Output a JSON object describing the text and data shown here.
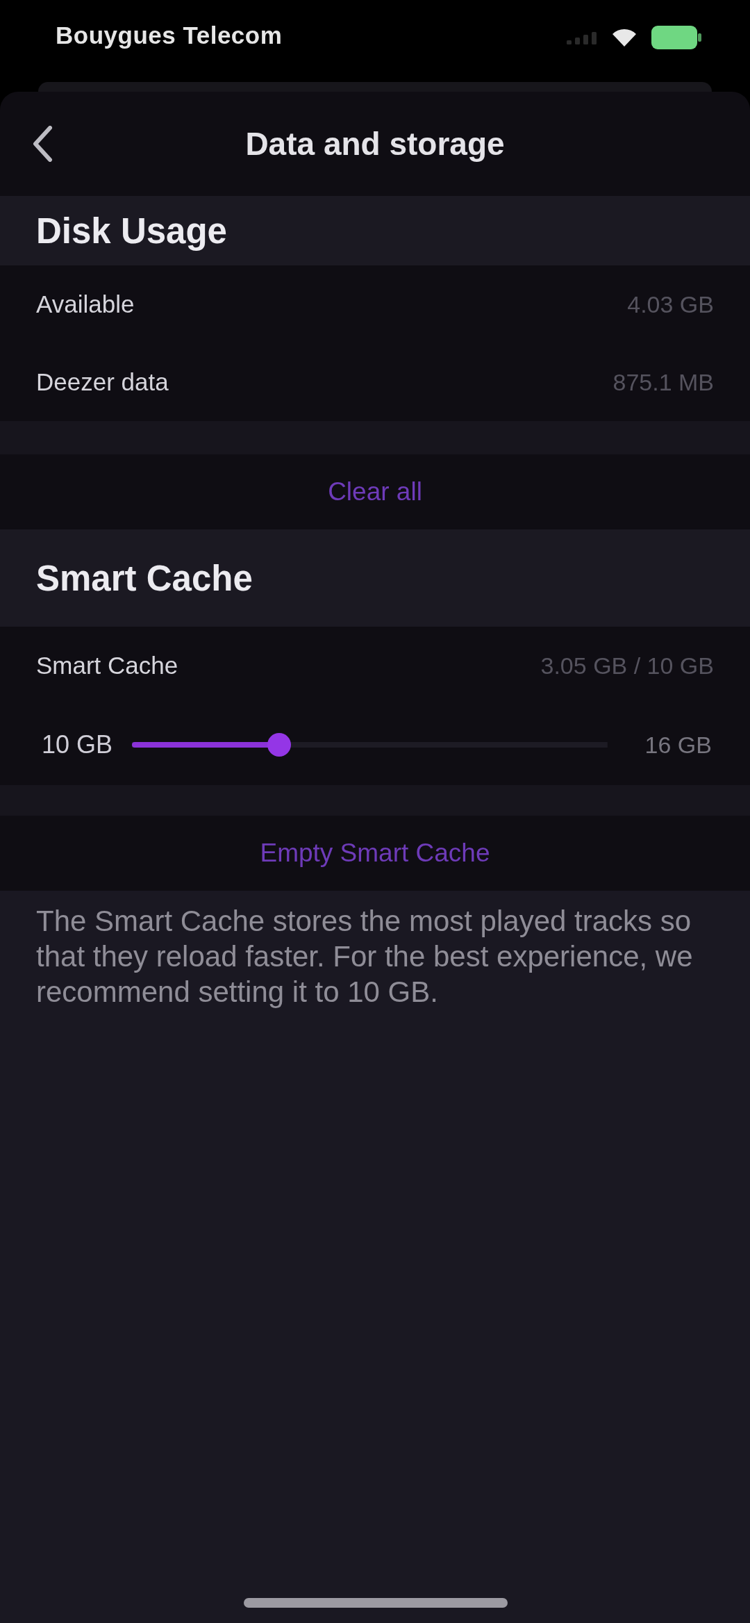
{
  "status_bar": {
    "carrier": "Bouygues Telecom"
  },
  "nav": {
    "title": "Data and storage"
  },
  "sections": [
    {
      "title": "Disk Usage",
      "rows": [
        {
          "kind": "info",
          "label": "Available",
          "value": "4.03 GB"
        },
        {
          "kind": "info",
          "label": "Deezer data",
          "value": "875.1 MB"
        }
      ],
      "action": "Clear all"
    },
    {
      "title": "Smart Cache",
      "rows": [
        {
          "kind": "info",
          "label": "Smart Cache",
          "value": "3.05 GB / 10 GB"
        },
        {
          "kind": "slider",
          "min_label": "10 GB",
          "level": 0.31,
          "max_label": "16 GB"
        }
      ],
      "action": "Empty Smart Cache",
      "footnote": "The Smart Cache stores the most played tracks so that they reload faster. For the best experience, we recommend setting it to 10 GB."
    }
  ]
}
